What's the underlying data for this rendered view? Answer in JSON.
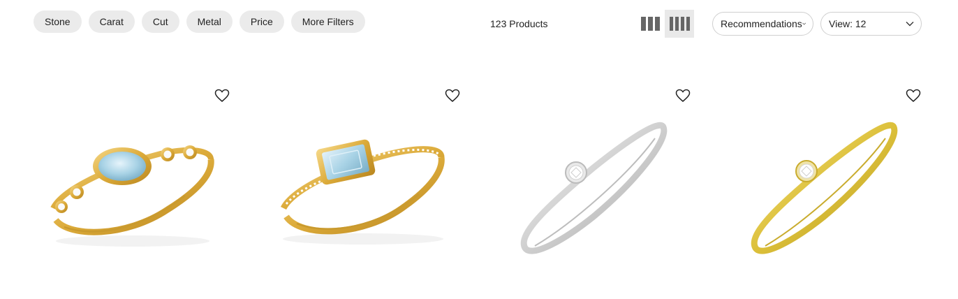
{
  "filters": [
    {
      "label": "Stone"
    },
    {
      "label": "Carat"
    },
    {
      "label": "Cut"
    },
    {
      "label": "Metal"
    },
    {
      "label": "Price"
    },
    {
      "label": "More Filters"
    }
  ],
  "product_count": "123 Products",
  "grid_options": {
    "selected": "4-column"
  },
  "sort": {
    "label": "Recommendations"
  },
  "view": {
    "label": "View: 12"
  },
  "colors": {
    "chip_bg": "#ebebeb",
    "gold": "#e2b640",
    "silver": "#d9d9d9",
    "aquamarine": "#a9d3e6"
  },
  "products": [
    {
      "image": "gold ring with oval aquamarine and bezel-set diamonds",
      "wishlist_icon": "heart-outline-icon"
    },
    {
      "image": "gold ring with emerald-cut aquamarine and pave diamond band",
      "wishlist_icon": "heart-outline-icon"
    },
    {
      "image": "white gold solitaire diamond ring",
      "wishlist_icon": "heart-outline-icon"
    },
    {
      "image": "yellow gold solitaire diamond ring",
      "wishlist_icon": "heart-outline-icon"
    }
  ]
}
